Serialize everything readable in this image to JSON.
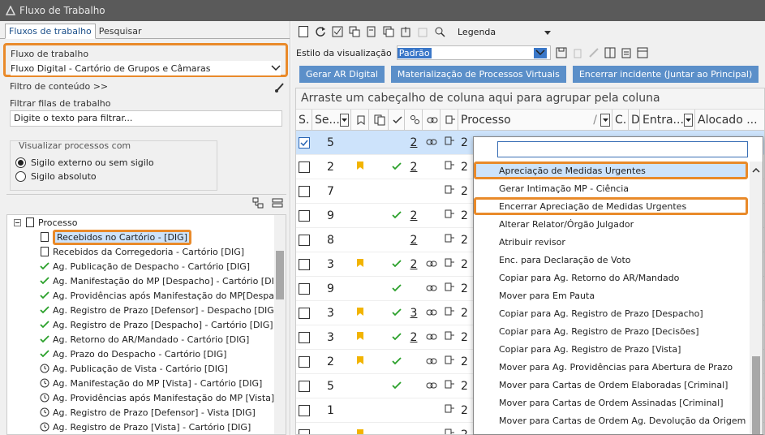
{
  "window": {
    "title": "Fluxo de Trabalho"
  },
  "left": {
    "tabs": [
      {
        "label": "Fluxos de trabalho"
      },
      {
        "label": "Pesquisar"
      }
    ],
    "fluxo": {
      "label": "Fluxo de trabalho",
      "value": "Fluxo Digital - Cartório de Grupos e Câmaras"
    },
    "filtro_conteudo": "Filtro de conteúdo >>",
    "filtrar": {
      "label": "Filtrar filas de trabalho",
      "placeholder": "Digite o texto para filtrar..."
    },
    "visualizar": {
      "label": "Visualizar processos com",
      "options": [
        {
          "label": "Sigilo externo ou sem sigilo"
        },
        {
          "label": "Sigilo absoluto"
        }
      ]
    },
    "tree": {
      "root": "Processo",
      "items": [
        {
          "label": "Recebidos no Cartório - [DIG]",
          "icon": "doc"
        },
        {
          "label": "Recebidos da Corregedoria - Cartório [DIG]",
          "icon": "doc"
        },
        {
          "label": "Ag. Publicação de Despacho - Cartório [DIG]",
          "icon": "check"
        },
        {
          "label": "Ag. Manifestação do MP [Despacho] - Cartório [DIG]",
          "icon": "check"
        },
        {
          "label": "Ag. Providências após Manifestação do MP[Despacho]",
          "icon": "check"
        },
        {
          "label": "Ag. Registro de Prazo [Defensor] - Despacho [DIG]",
          "icon": "check"
        },
        {
          "label": "Ag. Registro de Prazo [Despacho] - Cartório [DIG]",
          "icon": "check"
        },
        {
          "label": "Ag. Retorno do AR/Mandado - Cartório [DIG]",
          "icon": "check"
        },
        {
          "label": "Ag. Prazo do Despacho - Cartório [DIG]",
          "icon": "check"
        },
        {
          "label": "Ag. Publicação de Vista - Cartório [DIG]",
          "icon": "clock"
        },
        {
          "label": "Ag. Manifestação do MP [Vista] - Cartório [DIG]",
          "icon": "clock"
        },
        {
          "label": "Ag. Providências após Manifestação do MP [Vista]",
          "icon": "clock"
        },
        {
          "label": "Ag. Registro de Prazo [Defensor] - Vista [DIG]",
          "icon": "clock"
        },
        {
          "label": "Ag. Registro de Prazo [Vista] - Cartório [DIG]",
          "icon": "clock"
        }
      ]
    }
  },
  "right": {
    "toolbar": {
      "legenda": "Legenda"
    },
    "estilo": {
      "label": "Estilo da visualização",
      "value": "Padrão"
    },
    "buttons": [
      {
        "label": "Gerar AR Digital"
      },
      {
        "label": "Materialização de Processos Virtuais"
      },
      {
        "label": "Encerrar incidente (Juntar ao Principal)"
      }
    ],
    "group_hint": "Arraste um cabeçalho de coluna aqui para agrupar pela coluna",
    "columns": [
      "S.",
      "Se...",
      "Processo",
      "C.",
      "D",
      "Entra...",
      "Alocado ..."
    ],
    "rows": [
      {
        "se": "5",
        "flag": false,
        "check": false,
        "n": "2",
        "p": "2",
        "link": true
      },
      {
        "se": "2",
        "flag": true,
        "check": true,
        "n": "2",
        "p": "2",
        "link": false
      },
      {
        "se": "7",
        "flag": false,
        "check": false,
        "n": "",
        "p": "2",
        "link": false
      },
      {
        "se": "9",
        "flag": false,
        "check": true,
        "n": "2",
        "p": "2",
        "link": false
      },
      {
        "se": "8",
        "flag": false,
        "check": false,
        "n": "2",
        "p": "2",
        "link": false
      },
      {
        "se": "3",
        "flag": true,
        "check": true,
        "n": "2",
        "p": "2",
        "link": true
      },
      {
        "se": "9",
        "flag": false,
        "check": true,
        "n": "",
        "p": "2",
        "link": true
      },
      {
        "se": "3",
        "flag": true,
        "check": true,
        "n": "3",
        "p": "2",
        "link": true
      },
      {
        "se": "3",
        "flag": true,
        "check": true,
        "n": "2",
        "p": "2",
        "link": true
      },
      {
        "se": "2",
        "flag": true,
        "check": true,
        "n": "",
        "p": "2",
        "link": true
      },
      {
        "se": "5",
        "flag": false,
        "check": true,
        "n": "",
        "p": "2",
        "link": true
      },
      {
        "se": "1",
        "flag": false,
        "check": false,
        "n": "",
        "p": "2",
        "link": false
      },
      {
        "se": "",
        "flag": true,
        "check": false,
        "n": "",
        "p": "2",
        "link": false
      }
    ],
    "dropdown": {
      "items": [
        {
          "label": "Apreciação de Medidas Urgentes"
        },
        {
          "label": "Gerar Intimação MP - Ciência"
        },
        {
          "label": "Encerrar Apreciação de Medidas Urgentes"
        },
        {
          "label": "Alterar Relator/Órgão Julgador"
        },
        {
          "label": "Atribuir revisor"
        },
        {
          "label": "Enc. para Declaração de Voto"
        },
        {
          "label": "Copiar para Ag. Retorno do AR/Mandado"
        },
        {
          "label": "Mover para Em Pauta"
        },
        {
          "label": "Copiar para Ag. Registro de Prazo [Despacho]"
        },
        {
          "label": "Copiar para Ag. Registro de Prazo [Decisões]"
        },
        {
          "label": "Copiar para Ag. Registro de Prazo [Vista]"
        },
        {
          "label": "Mover para Ag. Providências para Abertura de Prazo"
        },
        {
          "label": "Mover para Cartas de Ordem Elaboradas [Criminal]"
        },
        {
          "label": "Mover para Cartas de Ordem Assinadas [Criminal]"
        },
        {
          "label": "Mover para Cartas de Ordem Ag. Devolução da Origem"
        }
      ]
    }
  }
}
